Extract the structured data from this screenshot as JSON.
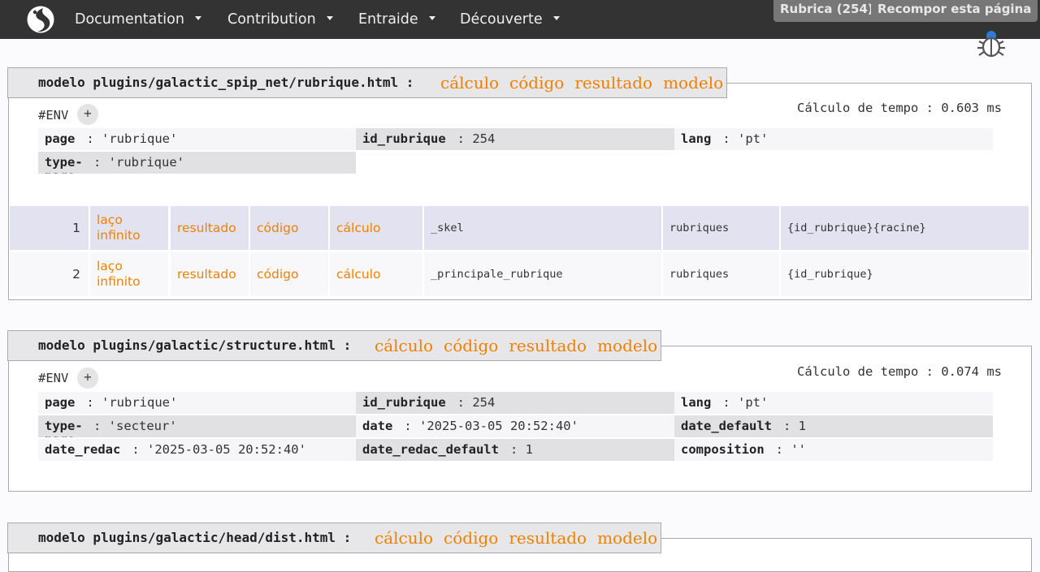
{
  "nav": {
    "items": [
      {
        "label": "Documentation"
      },
      {
        "label": "Contribution"
      },
      {
        "label": "Entraide"
      },
      {
        "label": "Découverte"
      }
    ],
    "admin_buttons": [
      {
        "label": "Rubrica (254)"
      },
      {
        "label": "Recompor esta página"
      }
    ]
  },
  "colors": {
    "link": "#f08000",
    "nav_bg": "#333333",
    "row_highlight": "#e2e2f1"
  },
  "header_links": [
    "cálculo",
    "código",
    "resultado",
    "modelo"
  ],
  "sections": [
    {
      "title": "modelo plugins/galactic_spip_net/rubrique.html :",
      "env_label": "#ENV",
      "env_toggle": "+",
      "timing": "Cálculo de tempo : 0.603 ms",
      "env": [
        {
          "key": "page",
          "value": ": 'rubrique'"
        },
        {
          "key": "id_rubrique",
          "value": ": 254"
        },
        {
          "key": "lang",
          "value": ": 'pt'"
        },
        {
          "key": "type-page",
          "value": ": 'rubrique'"
        }
      ],
      "loops": [
        {
          "index": "1",
          "infinite": "laço infinito",
          "result": "resultado",
          "code": "código",
          "calc": "cálculo",
          "name": "_skel",
          "table": "rubriques",
          "criteria": "{id_rubrique}{racine}"
        },
        {
          "index": "2",
          "infinite": "laço infinito",
          "result": "resultado",
          "code": "código",
          "calc": "cálculo",
          "name": "_principale_rubrique",
          "table": "rubriques",
          "criteria": "{id_rubrique}"
        }
      ]
    },
    {
      "title": "modelo plugins/galactic/structure.html :",
      "env_label": "#ENV",
      "env_toggle": "+",
      "timing": "Cálculo de tempo : 0.074 ms",
      "env": [
        {
          "key": "page",
          "value": ": 'rubrique'"
        },
        {
          "key": "id_rubrique",
          "value": ": 254"
        },
        {
          "key": "lang",
          "value": ": 'pt'"
        },
        {
          "key": "type-page",
          "value": ": 'secteur'"
        },
        {
          "key": "date",
          "value": ": '2025-03-05 20:52:40'"
        },
        {
          "key": "date_default",
          "value": ": 1"
        },
        {
          "key": "date_redac",
          "value": ": '2025-03-05 20:52:40'"
        },
        {
          "key": "date_redac_default",
          "value": ": 1"
        },
        {
          "key": "composition",
          "value": ": ''"
        }
      ]
    },
    {
      "title": "modelo plugins/galactic/head/dist.html :"
    }
  ]
}
